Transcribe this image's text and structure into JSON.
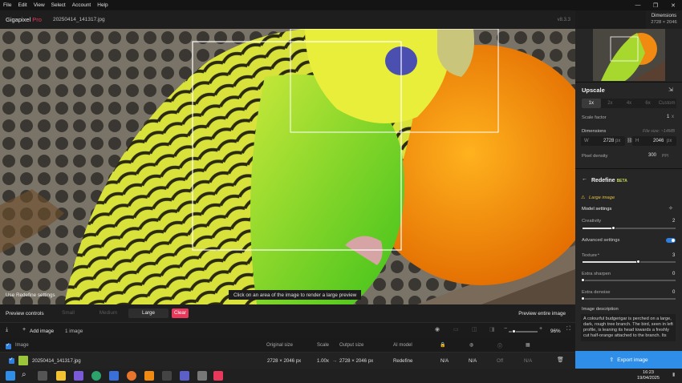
{
  "menubar": {
    "items": [
      "File",
      "Edit",
      "View",
      "Select",
      "Account",
      "Help"
    ]
  },
  "window_controls": {
    "minimize": "—",
    "maximize": "❐",
    "close": "✕"
  },
  "titlebar": {
    "app_name": "Gigapixel",
    "app_edition": "Pro",
    "file_name": "20250414_141317.jpg",
    "version": "v8.3.3"
  },
  "dimensions_badge": {
    "title": "Dimensions",
    "value": "2728 × 2046"
  },
  "canvas": {
    "hint": "Click on an area of the image to render a large preview",
    "use_redefine": "Use Redefine settings"
  },
  "sidebar": {
    "upscale": {
      "title": "Upscale",
      "scale_options": [
        "1x",
        "2x",
        "4x",
        "6x",
        "Custom"
      ],
      "scale_selected": "1x",
      "scale_factor_label": "Scale factor",
      "scale_factor_value": "1",
      "scale_factor_unit": "x",
      "dimensions_label": "Dimensions",
      "file_size": "File size: ~14MB",
      "w_label": "W",
      "w_value": "2728",
      "w_unit": "px",
      "h_label": "H",
      "h_value": "2046",
      "h_unit": "px",
      "pixel_density_label": "Pixel density",
      "pixel_density_value": "300",
      "pixel_density_unit": "PPI"
    },
    "redefine": {
      "title": "Redefine",
      "badge": "BETA",
      "model_type": "Large image",
      "model_settings_label": "Model settings",
      "creativity_label": "Creativity",
      "creativity_value": "2",
      "creativity_level": 0.33,
      "advanced_label": "Advanced settings",
      "advanced_on": true,
      "texture_label": "Texture",
      "texture_value": "3",
      "texture_level": 0.6,
      "sharpen_label": "Extra sharpen",
      "sharpen_value": "0",
      "denoise_label": "Extra denoise",
      "denoise_value": "0",
      "description_label": "Image description",
      "description": "A colourful budgerigar is perched on a large, dark, rough tree branch. The bird, seen in left profile, is leaning its head towards a freshly cut half-orange attached to the branch. Its"
    },
    "export_label": "Export image"
  },
  "preview_controls": {
    "label": "Preview controls",
    "sizes": [
      "Small",
      "Medium",
      "Large"
    ],
    "selected": "Large",
    "clear_label": "Clear",
    "entire_label": "Preview entire image"
  },
  "list_toolbar": {
    "add_label": "Add image",
    "count": "1 image",
    "zoom": "96%"
  },
  "table": {
    "headers": {
      "image": "Image",
      "original": "Original size",
      "scale": "Scale",
      "output": "Output size",
      "model": "AI model"
    },
    "row": {
      "name": "20250414_141317.jpg",
      "original": "2728 × 2046 px",
      "scale": "1.00x",
      "output": "2728 × 2046 px",
      "model": "Redefine",
      "c1": "N/A",
      "c2": "N/A",
      "c3": "Off",
      "c4": "N/A"
    }
  },
  "taskbar": {
    "time": "16:23",
    "date": "19/04/2025"
  },
  "colors": {
    "accent_red": "#e8385b",
    "accent_blue": "#2f8fe8",
    "beta_yellow": "#c6d85a"
  }
}
